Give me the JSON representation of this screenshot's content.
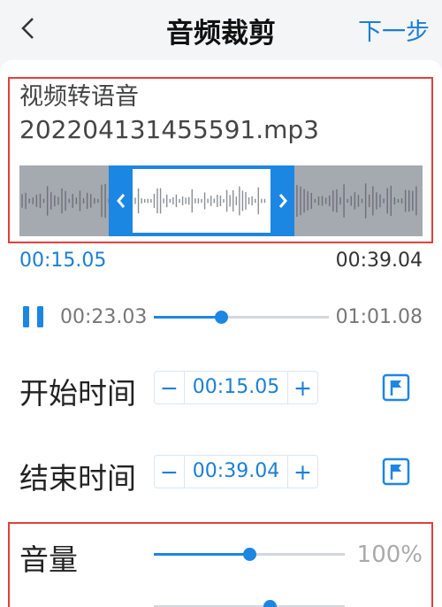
{
  "header": {
    "title": "音频裁剪",
    "next_label": "下一步",
    "back_icon": "chevron-left-icon"
  },
  "file": {
    "name_line1": "视频转语音",
    "name_line2": "202204131455591.mp3"
  },
  "selection": {
    "start_label": "00:15.05",
    "end_label": "00:39.04",
    "start_fraction": 0.222,
    "end_fraction": 0.683
  },
  "player": {
    "state": "playing",
    "current_time": "00:23.03",
    "total_time": "01:01.08",
    "progress_fraction": 0.384
  },
  "start_time": {
    "label": "开始时间",
    "value": "00:15.05",
    "minus": "−",
    "plus": "+"
  },
  "end_time": {
    "label": "结束时间",
    "value": "00:39.04",
    "minus": "−",
    "plus": "+"
  },
  "volume": {
    "label": "音量",
    "value": "100%",
    "fraction": 0.5
  },
  "colors": {
    "accent": "#1c86e3",
    "highlight_border": "#e0403a",
    "wave_bg": "#a5a9b0"
  }
}
